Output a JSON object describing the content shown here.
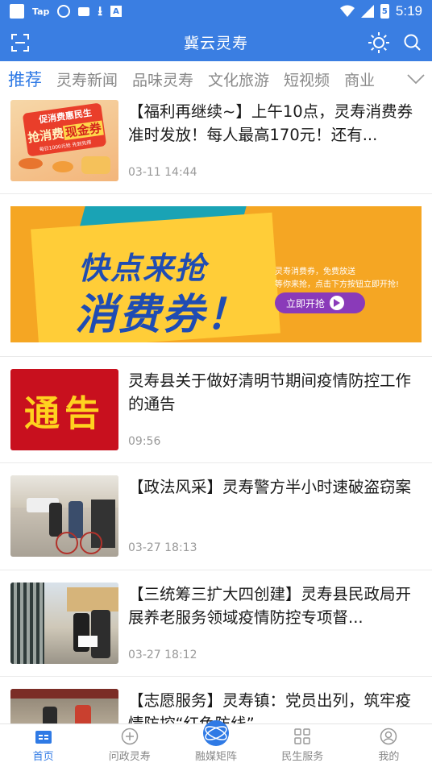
{
  "status_bar": {
    "tag": "Tap",
    "a_icon": "A",
    "time": "5:19",
    "battery": "5"
  },
  "app_bar": {
    "title": "冀云灵寿",
    "left_icon": "scan-icon",
    "right_icons": [
      "brightness-icon",
      "search-icon"
    ]
  },
  "tabs": [
    {
      "label": "推荐",
      "active": true
    },
    {
      "label": "灵寿新闻"
    },
    {
      "label": "品味灵寿"
    },
    {
      "label": "文化旅游"
    },
    {
      "label": "短视频"
    },
    {
      "label": "商业"
    }
  ],
  "feed": [
    {
      "title": "【福利再继续~】上午10点，灵寿消费券准时发放！每人最高170元！还有...",
      "time": "03-11 14:44",
      "thumb": {
        "line1": "促消费惠民生",
        "line2": "抢消费",
        "line3": "现金券",
        "sub": "每日1000元抢  先到先得"
      }
    },
    {
      "banner": {
        "headline1": "快点来抢",
        "headline2": "消费券！",
        "desc1": "灵寿消费券，免费放送",
        "desc2": "等你来抢，点击下方按钮立即开抢!",
        "button": "立即开抢"
      }
    },
    {
      "title": "灵寿县关于做好清明节期间疫情防控工作的通告",
      "time": "09:56",
      "thumb": {
        "text": "通告"
      }
    },
    {
      "title": "【政法风采】灵寿警方半小时速破盗窃案",
      "time": "03-27 18:13"
    },
    {
      "title": "【三统筹三扩大四创建】灵寿县民政局开展养老服务领域疫情防控专项督...",
      "time": "03-27 18:12"
    },
    {
      "title": "【志愿服务】灵寿镇：党员出列，筑牢疫情防控“红色防线”"
    }
  ],
  "bottom_nav": [
    {
      "label": "首页",
      "icon": "home-icon",
      "active": true
    },
    {
      "label": "问政灵寿",
      "icon": "plus-circle-icon"
    },
    {
      "label": "融媒矩阵",
      "icon": "globe-icon"
    },
    {
      "label": "民生服务",
      "icon": "grid-icon"
    },
    {
      "label": "我的",
      "icon": "profile-icon"
    }
  ],
  "colors": {
    "primary": "#3a7ee2",
    "active_tab": "#2f7ae5",
    "banner_bg": "#f5a623",
    "notice_red": "#c8101e"
  }
}
